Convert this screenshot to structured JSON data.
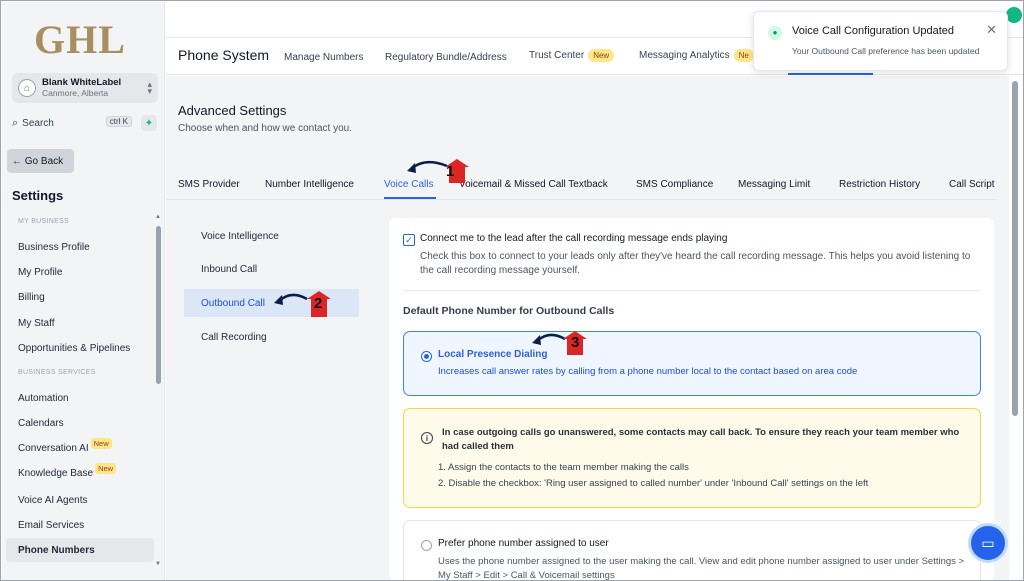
{
  "sidebar": {
    "logo": "GHL",
    "account": {
      "name": "Blank WhiteLabel",
      "location": "Canmore, Alberta"
    },
    "search": {
      "label": "Search",
      "shortcut": "ctrl K"
    },
    "go_back": "Go Back",
    "title": "Settings",
    "section_business": "MY BUSINESS",
    "section_services": "BUSINESS SERVICES",
    "items": [
      {
        "label": "Business Profile"
      },
      {
        "label": "My Profile"
      },
      {
        "label": "Billing"
      },
      {
        "label": "My Staff"
      },
      {
        "label": "Opportunities & Pipelines"
      },
      {
        "label": "Automation"
      },
      {
        "label": "Calendars"
      },
      {
        "label": "Conversation AI",
        "badge": "New"
      },
      {
        "label": "Knowledge Base",
        "badge": "New"
      },
      {
        "label": "Voice AI Agents"
      },
      {
        "label": "Email Services"
      },
      {
        "label": "Phone Numbers"
      }
    ]
  },
  "header": {
    "title": "Phone System",
    "tabs": [
      {
        "label": "Manage Numbers"
      },
      {
        "label": "Regulatory Bundle/Address"
      },
      {
        "label": "Trust Center",
        "badge": "New"
      },
      {
        "label": "Messaging Analytics",
        "badge": "Ne"
      }
    ]
  },
  "page": {
    "title": "Advanced Settings",
    "subtitle": "Choose when and how we contact you.",
    "tabs": [
      {
        "label": "SMS Provider"
      },
      {
        "label": "Number Intelligence"
      },
      {
        "label": "Voice Calls"
      },
      {
        "label": "Voicemail & Missed Call Textback"
      },
      {
        "label": "SMS Compliance"
      },
      {
        "label": "Messaging Limit"
      },
      {
        "label": "Restriction History"
      },
      {
        "label": "Call Script"
      }
    ],
    "subnav": [
      {
        "label": "Voice Intelligence"
      },
      {
        "label": "Inbound Call"
      },
      {
        "label": "Outbound Call"
      },
      {
        "label": "Call Recording"
      }
    ]
  },
  "panel": {
    "checkbox_label": "Connect me to the lead after the call recording message ends playing",
    "checkbox_desc": "Check this box to connect to your leads only after they've heard the call recording message. This helps you avoid listening to the call recording message yourself.",
    "section_title": "Default Phone Number for Outbound Calls",
    "option1": {
      "title": "Local Presence Dialing",
      "desc": "Increases call answer rates by calling from a phone number local to the contact based on area code"
    },
    "info": {
      "title": "In case outgoing calls go unanswered, some contacts may call back. To ensure they reach your team member who had called them",
      "steps": [
        "1. Assign the contacts to the team member making the calls",
        "2. Disable the checkbox: 'Ring user assigned to called number' under 'Inbound Call' settings on the left"
      ]
    },
    "option2": {
      "title": "Prefer phone number assigned to user",
      "desc": "Uses the phone number assigned to the user making the call. View and edit phone number assigned to user under Settings > My Staff > Edit > Call & Voicemail settings"
    }
  },
  "toast": {
    "title": "Voice Call Configuration Updated",
    "body": "Your Outbound Call preference has been updated"
  },
  "annotations": [
    "1",
    "2",
    "3"
  ],
  "colors": {
    "accent": "#2563eb",
    "logo": "#a88f60",
    "badge": "#fde68a"
  }
}
